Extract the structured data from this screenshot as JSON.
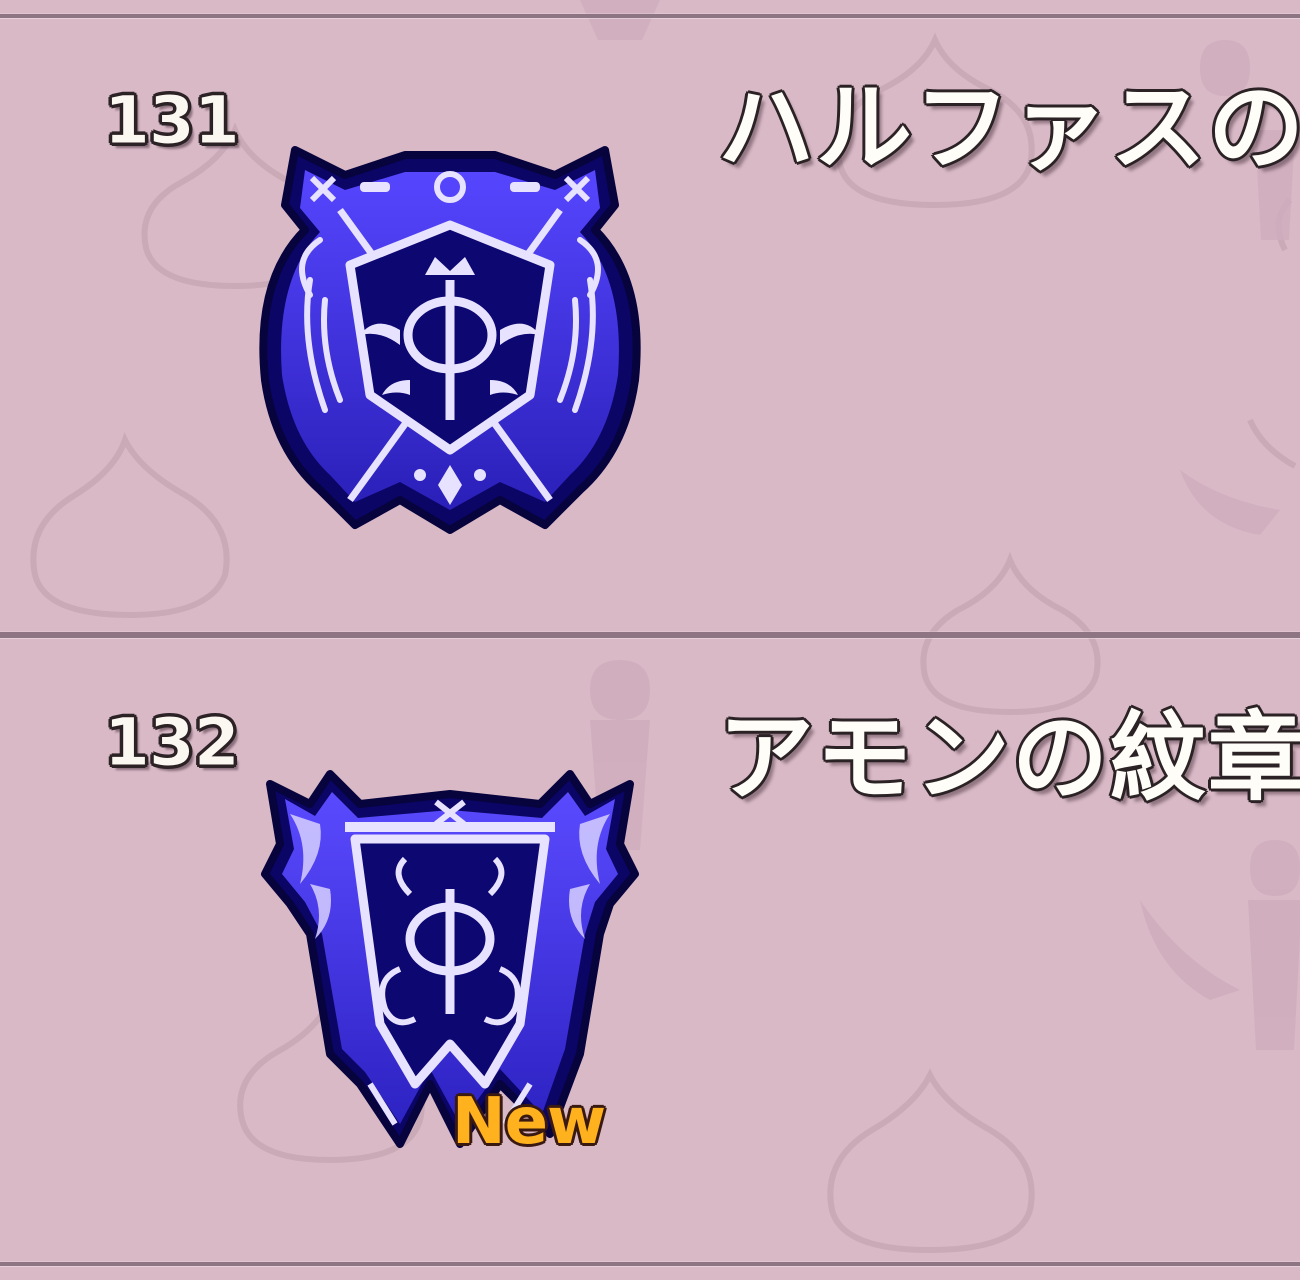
{
  "theme": {
    "background": "#d9b9c6",
    "divider": "#8e7583",
    "emblem_outline": "#0a0560",
    "emblem_fill": "#3b2ed8",
    "emblem_light": "#e7e2ff",
    "new_color": "#ffb21e"
  },
  "list": {
    "items": [
      {
        "number": "131",
        "name": "ハルファスの",
        "icon": "halphas-crest-icon",
        "is_new": false
      },
      {
        "number": "132",
        "name": "アモンの紋章",
        "icon": "amon-crest-icon",
        "is_new": true,
        "badge": "New"
      }
    ]
  }
}
